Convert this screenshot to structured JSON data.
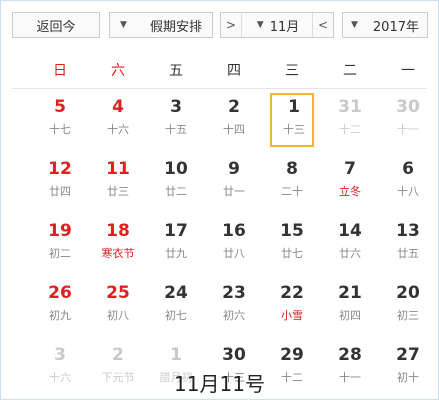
{
  "toolbar": {
    "year_label": "2017年",
    "month_label": "11月",
    "prev_month": "<",
    "next_month": ">",
    "holiday_label": "假期安排",
    "today_label": "返回今"
  },
  "weekdays": [
    "一",
    "二",
    "三",
    "四",
    "五",
    "六",
    "日"
  ],
  "weeks": [
    [
      {
        "day": "30",
        "lunar": "十一",
        "other": true
      },
      {
        "day": "31",
        "lunar": "十二",
        "other": true
      },
      {
        "day": "1",
        "lunar": "十三",
        "selected": true
      },
      {
        "day": "2",
        "lunar": "十四"
      },
      {
        "day": "3",
        "lunar": "十五"
      },
      {
        "day": "4",
        "lunar": "十六",
        "weekend": true
      },
      {
        "day": "5",
        "lunar": "十七",
        "weekend": true
      }
    ],
    [
      {
        "day": "6",
        "lunar": "十八"
      },
      {
        "day": "7",
        "lunar": "立冬",
        "festival": true
      },
      {
        "day": "8",
        "lunar": "二十"
      },
      {
        "day": "9",
        "lunar": "廿一"
      },
      {
        "day": "10",
        "lunar": "廿二"
      },
      {
        "day": "11",
        "lunar": "廿三",
        "weekend": true
      },
      {
        "day": "12",
        "lunar": "廿四",
        "weekend": true
      }
    ],
    [
      {
        "day": "13",
        "lunar": "廿五"
      },
      {
        "day": "14",
        "lunar": "廿六"
      },
      {
        "day": "15",
        "lunar": "廿七"
      },
      {
        "day": "16",
        "lunar": "廿八"
      },
      {
        "day": "17",
        "lunar": "廿九"
      },
      {
        "day": "18",
        "lunar": "寒衣节",
        "weekend": true,
        "festival": true
      },
      {
        "day": "19",
        "lunar": "初二",
        "weekend": true
      }
    ],
    [
      {
        "day": "20",
        "lunar": "初三"
      },
      {
        "day": "21",
        "lunar": "初四"
      },
      {
        "day": "22",
        "lunar": "小雪",
        "festival": true
      },
      {
        "day": "23",
        "lunar": "初六"
      },
      {
        "day": "24",
        "lunar": "初七"
      },
      {
        "day": "25",
        "lunar": "初八",
        "weekend": true
      },
      {
        "day": "26",
        "lunar": "初九",
        "weekend": true
      }
    ],
    [
      {
        "day": "27",
        "lunar": "初十"
      },
      {
        "day": "28",
        "lunar": "十一"
      },
      {
        "day": "29",
        "lunar": "十二"
      },
      {
        "day": "30",
        "lunar": "十三"
      },
      {
        "day": "1",
        "lunar": "腊月初",
        "other": true
      },
      {
        "day": "2",
        "lunar": "下元节",
        "other": true
      },
      {
        "day": "3",
        "lunar": "十六",
        "other": true
      }
    ]
  ],
  "caption": "11月11号"
}
